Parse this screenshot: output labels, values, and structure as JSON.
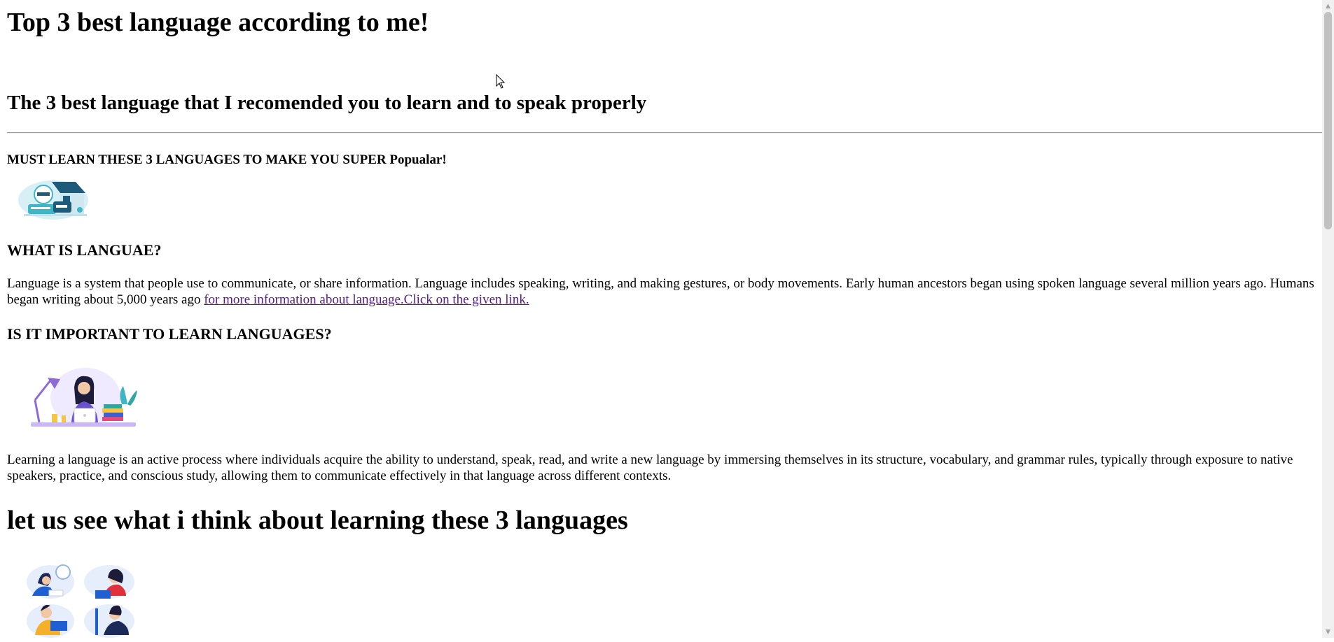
{
  "main_heading": "Top 3 best language according to me!",
  "sub_heading": "The 3 best language that I recomended you to learn and to speak properly",
  "tagline": "MUST LEARN THESE 3 LANGUAGES TO MAKE YOU SUPER Popualar!",
  "section1": {
    "heading": "WHAT IS LANGUAE?",
    "text": "Language is a system that people use to communicate, or share information. Language includes speaking, writing, and making gestures, or body movements. Early human ancestors began using spoken language several million years ago. Humans began writing about 5,000 years ago ",
    "link": "for more information about language.Click on the given link."
  },
  "section2": {
    "heading": "IS IT IMPORTANT TO LEARN LANGUAGES?",
    "text": "Learning a language is an active process where individuals acquire the ability to understand, speak, read, and write a new language by immersing themselves in its structure, vocabulary, and grammar rules, typically through exposure to native speakers, practice, and conscious study, allowing them to communicate effectively in that language across different contexts."
  },
  "section3": {
    "heading": "let us see what i think about learning these 3 languages"
  },
  "colors": {
    "link_visited": "#551a8b",
    "illustration_teal": "#3fb6c6",
    "illustration_purple": "#8e6ad8",
    "illustration_blue": "#1f5fd1"
  }
}
